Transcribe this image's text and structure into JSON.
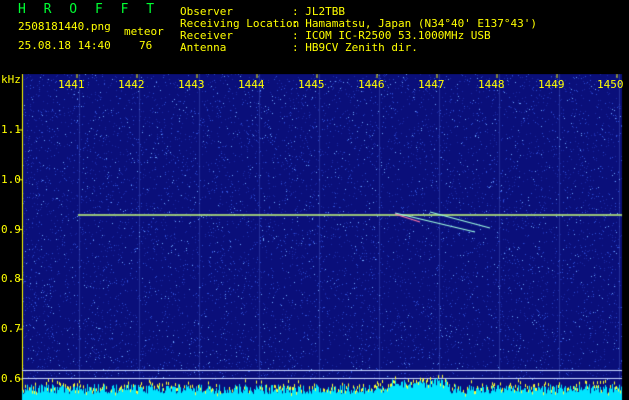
{
  "header": {
    "app_title": "H R O F F T",
    "filename": "2508181440.png",
    "datetime": "25.08.18 14:40",
    "mode_label": "meteor",
    "mode_value": "76",
    "fields": [
      {
        "label": "Observer",
        "value": ": JL2TBB"
      },
      {
        "label": "Receiving Location",
        "value": ": Hamamatsu, Japan (N34°40' E137°43')"
      },
      {
        "label": "Receiver",
        "value": ": ICOM IC-R2500 53.1000MHz USB"
      },
      {
        "label": "Antenna",
        "value": ": HB9CV Zenith dir."
      }
    ]
  },
  "axis": {
    "unit": "kHz",
    "y_ticks": [
      "1.1",
      "1.0",
      "0.9",
      "0.8",
      "0.7",
      "0.6"
    ],
    "x_ticks": [
      "1441",
      "1442",
      "1443",
      "1444",
      "1445",
      "1446",
      "1447",
      "1448",
      "1449",
      "1450"
    ]
  },
  "colors": {
    "background": "#0a0f7a",
    "text": "#ffff00",
    "title": "#00ff33",
    "trace": "#c8ff7a",
    "meteor_trail": "#a0ffe0",
    "noise_bar": "#00e5ff"
  }
}
